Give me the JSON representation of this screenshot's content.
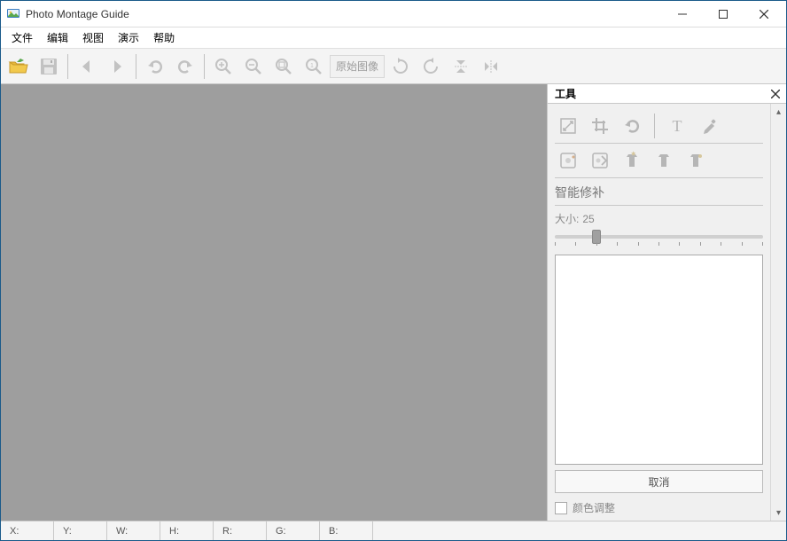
{
  "window": {
    "title": "Photo Montage Guide"
  },
  "menu": [
    "文件",
    "编辑",
    "视图",
    "演示",
    "帮助"
  ],
  "toolbar": {
    "original_image": "原始图像"
  },
  "panel": {
    "title": "工具",
    "section_title": "智能修补",
    "size_label": "大小:",
    "size_value": "25",
    "cancel": "取消",
    "color_adjust": "颜色调整"
  },
  "status": {
    "x": "X:",
    "y": "Y:",
    "w": "W:",
    "h": "H:",
    "r": "R:",
    "g": "G:",
    "b": "B:"
  }
}
